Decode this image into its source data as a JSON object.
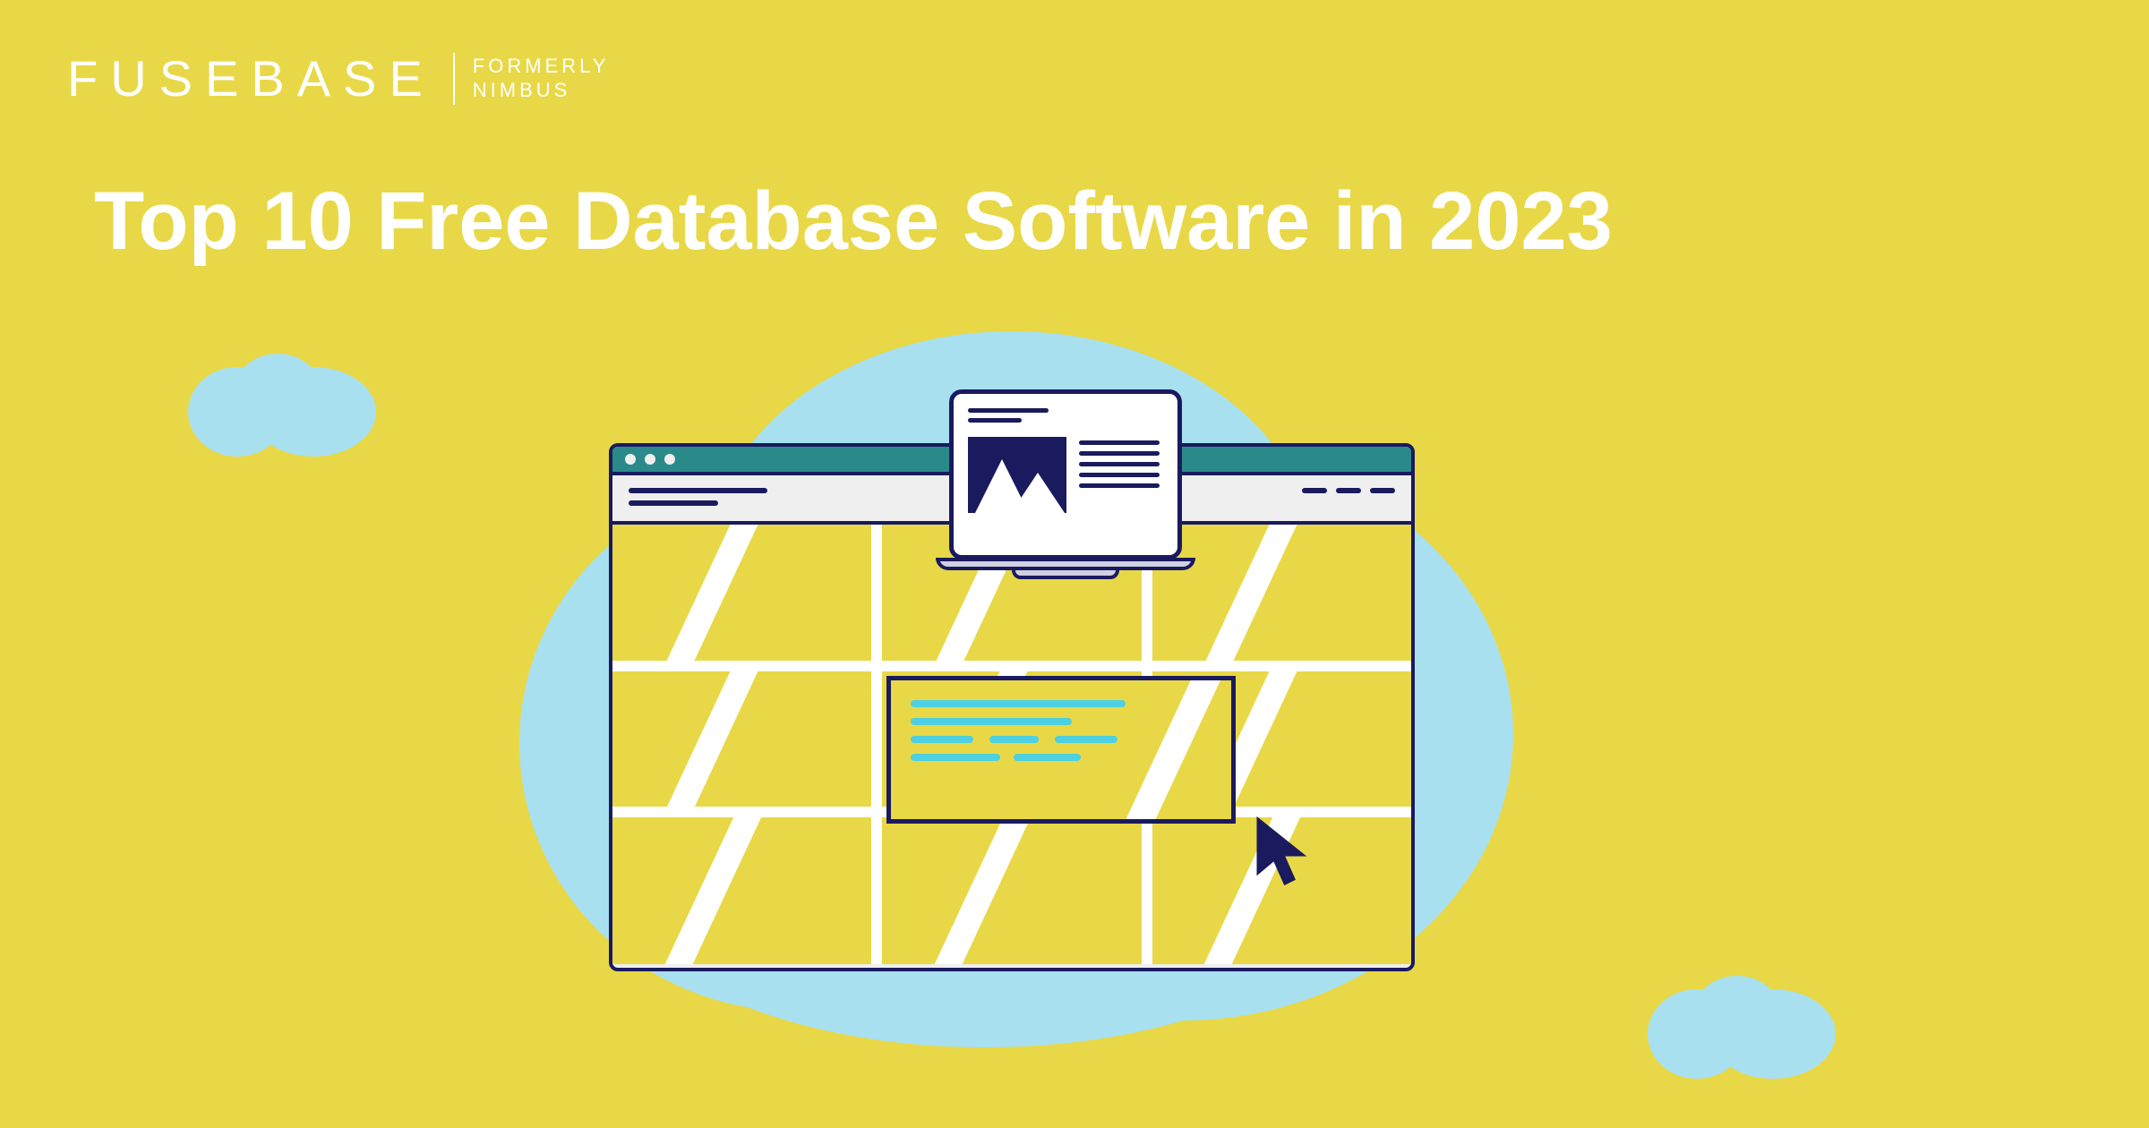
{
  "brand": {
    "name": "FUSEBASE",
    "formerly_line1": "FORMERLY",
    "formerly_line2": "NIMBUS"
  },
  "title": "Top 10 Free Database Software in 2023",
  "colors": {
    "background": "#e8d847",
    "cloud": "#a8e0f0",
    "navy": "#1a1a5e",
    "teal": "#2a8a8a",
    "cyan": "#4dd0e1"
  }
}
